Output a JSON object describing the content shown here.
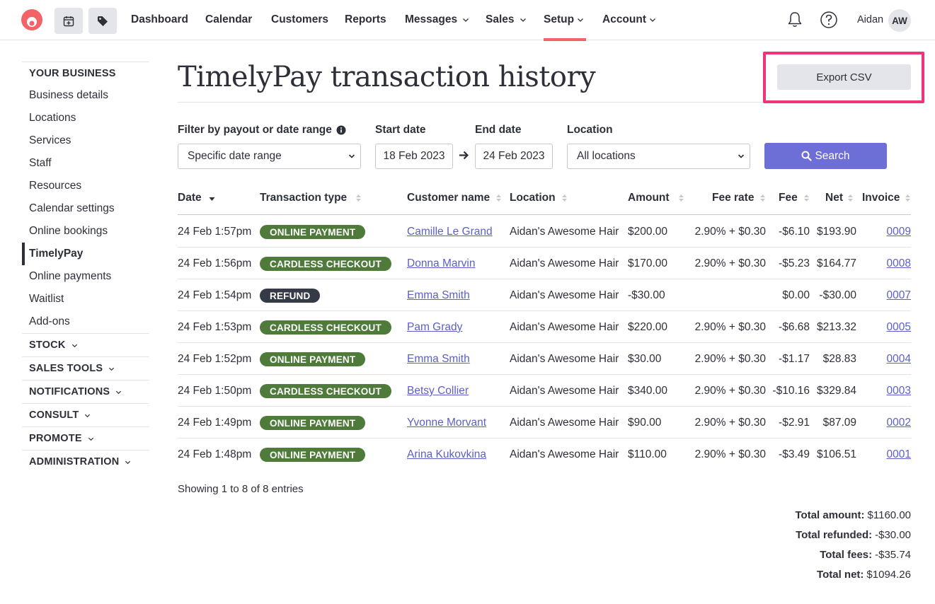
{
  "nav": {
    "items": [
      {
        "label": "Dashboard",
        "dropdown": false
      },
      {
        "label": "Calendar",
        "dropdown": false
      },
      {
        "label": "Customers",
        "dropdown": false
      },
      {
        "label": "Reports",
        "dropdown": false
      },
      {
        "label": "Messages",
        "dropdown": true
      },
      {
        "label": "Sales",
        "dropdown": true
      },
      {
        "label": "Setup",
        "dropdown": true,
        "active": true
      },
      {
        "label": "Account",
        "dropdown": true
      }
    ],
    "user_name": "Aidan",
    "avatar_initials": "AW",
    "accent_color": "#f26369"
  },
  "sidebar": {
    "section_title": "YOUR BUSINESS",
    "items": [
      {
        "label": "Business details"
      },
      {
        "label": "Locations"
      },
      {
        "label": "Services"
      },
      {
        "label": "Staff"
      },
      {
        "label": "Resources"
      },
      {
        "label": "Calendar settings"
      },
      {
        "label": "Online bookings"
      },
      {
        "label": "TimelyPay",
        "active": true
      },
      {
        "label": "Online payments"
      },
      {
        "label": "Waitlist"
      },
      {
        "label": "Add-ons"
      }
    ],
    "groups": [
      {
        "label": "STOCK"
      },
      {
        "label": "SALES TOOLS"
      },
      {
        "label": "NOTIFICATIONS"
      },
      {
        "label": "CONSULT"
      },
      {
        "label": "PROMOTE"
      },
      {
        "label": "ADMINISTRATION"
      }
    ]
  },
  "page": {
    "title": "TimelyPay transaction history",
    "export_label": "Export CSV",
    "highlight_color": "#f0337a"
  },
  "filters": {
    "range_label": "Filter by payout or date range",
    "range_value": "Specific date range",
    "start_label": "Start date",
    "start_value": "18 Feb 2023",
    "end_label": "End date",
    "end_value": "24 Feb 2023",
    "location_label": "Location",
    "location_value": "All locations",
    "search_label": "Search",
    "search_color": "#6e6fd6"
  },
  "table": {
    "columns": [
      "Date",
      "Transaction type",
      "Customer name",
      "Location",
      "Amount",
      "Fee rate",
      "Fee",
      "Net",
      "Invoice"
    ],
    "badge_colors": {
      "ONLINE PAYMENT": "#4e7a3a",
      "CARDLESS CHECKOUT": "#4e7a3a",
      "REFUND": "#343a46"
    },
    "rows": [
      {
        "date": "24 Feb 1:57pm",
        "type": "ONLINE PAYMENT",
        "customer": "Camille Le Grand",
        "location": "Aidan's Awesome Hair",
        "amount": "$200.00",
        "fee_rate": "2.90% + $0.30",
        "fee": "-$6.10",
        "net": "$193.90",
        "invoice": "0009"
      },
      {
        "date": "24 Feb 1:56pm",
        "type": "CARDLESS CHECKOUT",
        "customer": "Donna Marvin",
        "location": "Aidan's Awesome Hair",
        "amount": "$170.00",
        "fee_rate": "2.90% + $0.30",
        "fee": "-$5.23",
        "net": "$164.77",
        "invoice": "0008"
      },
      {
        "date": "24 Feb 1:54pm",
        "type": "REFUND",
        "customer": "Emma Smith",
        "location": "Aidan's Awesome Hair",
        "amount": "-$30.00",
        "fee_rate": "",
        "fee": "$0.00",
        "net": "-$30.00",
        "invoice": "0007"
      },
      {
        "date": "24 Feb 1:53pm",
        "type": "CARDLESS CHECKOUT",
        "customer": "Pam Grady",
        "location": "Aidan's Awesome Hair",
        "amount": "$220.00",
        "fee_rate": "2.90% + $0.30",
        "fee": "-$6.68",
        "net": "$213.32",
        "invoice": "0005"
      },
      {
        "date": "24 Feb 1:52pm",
        "type": "ONLINE PAYMENT",
        "customer": "Emma Smith",
        "location": "Aidan's Awesome Hair",
        "amount": "$30.00",
        "fee_rate": "2.90% + $0.30",
        "fee": "-$1.17",
        "net": "$28.83",
        "invoice": "0004"
      },
      {
        "date": "24 Feb 1:50pm",
        "type": "CARDLESS CHECKOUT",
        "customer": "Betsy Collier",
        "location": "Aidan's Awesome Hair",
        "amount": "$340.00",
        "fee_rate": "2.90% + $0.30",
        "fee": "-$10.16",
        "net": "$329.84",
        "invoice": "0003"
      },
      {
        "date": "24 Feb 1:49pm",
        "type": "ONLINE PAYMENT",
        "customer": "Yvonne Morvant",
        "location": "Aidan's Awesome Hair",
        "amount": "$90.00",
        "fee_rate": "2.90% + $0.30",
        "fee": "-$2.91",
        "net": "$87.09",
        "invoice": "0002"
      },
      {
        "date": "24 Feb 1:48pm",
        "type": "ONLINE PAYMENT",
        "customer": "Arina Kukovkina",
        "location": "Aidan's Awesome Hair",
        "amount": "$110.00",
        "fee_rate": "2.90% + $0.30",
        "fee": "-$3.49",
        "net": "$106.51",
        "invoice": "0001"
      }
    ]
  },
  "summary": {
    "showing": "Showing 1 to 8 of 8 entries",
    "totals": [
      {
        "label": "Total amount:",
        "value": "$1160.00"
      },
      {
        "label": "Total refunded:",
        "value": "-$30.00"
      },
      {
        "label": "Total fees:",
        "value": "-$35.74"
      },
      {
        "label": "Total net:",
        "value": "$1094.26"
      }
    ]
  }
}
